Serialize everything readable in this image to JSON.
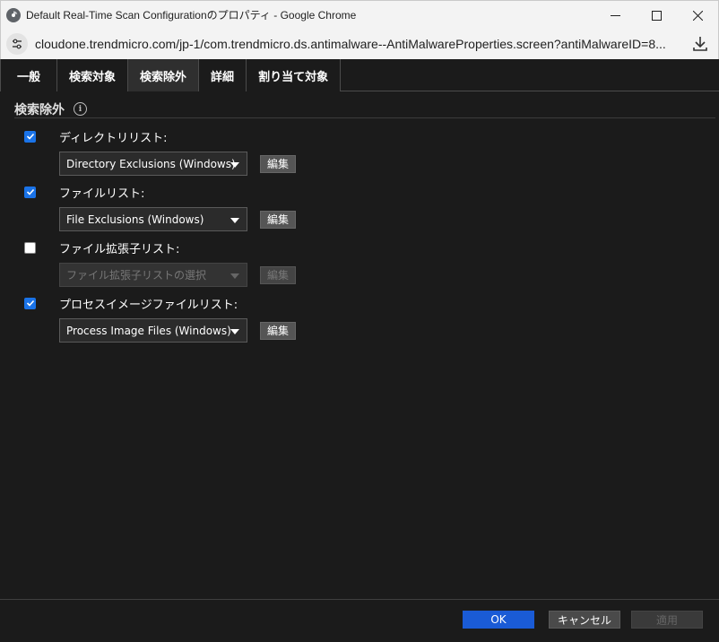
{
  "window": {
    "title": "Default Real-Time Scan Configurationのプロパティ - Google Chrome",
    "url": "cloudone.trendmicro.com/jp-1/com.trendmicro.ds.antimalware--AntiMalwareProperties.screen?antiMalwareID=8..."
  },
  "tabs": [
    {
      "label": "一般",
      "active": false
    },
    {
      "label": "検索対象",
      "active": false
    },
    {
      "label": "検索除外",
      "active": true
    },
    {
      "label": "詳細",
      "active": false
    },
    {
      "label": "割り当て対象",
      "active": false
    }
  ],
  "section": {
    "title": "検索除外",
    "info_icon_glyph": "i"
  },
  "options": [
    {
      "label": "ディレクトリリスト:",
      "checked": true,
      "select_value": "Directory Exclusions (Windows)",
      "edit_label": "編集",
      "disabled": false
    },
    {
      "label": "ファイルリスト:",
      "checked": true,
      "select_value": "File Exclusions (Windows)",
      "edit_label": "編集",
      "disabled": false
    },
    {
      "label": "ファイル拡張子リスト:",
      "checked": false,
      "select_value": "ファイル拡張子リストの選択",
      "edit_label": "編集",
      "disabled": true
    },
    {
      "label": "プロセスイメージファイルリスト:",
      "checked": true,
      "select_value": "Process Image Files (Windows)",
      "edit_label": "編集",
      "disabled": false
    }
  ],
  "footer": {
    "ok_label": "OK",
    "cancel_label": "キャンセル",
    "apply_label": "適用"
  },
  "colors": {
    "accent": "#1a73e8",
    "ok_button": "#1a5bd6",
    "background": "#1b1b1b"
  }
}
